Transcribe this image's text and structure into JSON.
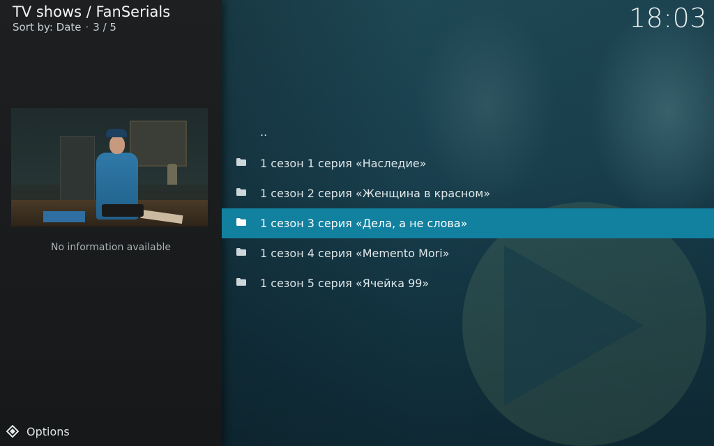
{
  "header": {
    "title": "TV shows / FanSerials",
    "sort_label": "Sort by: Date",
    "separator": "·",
    "position": "3 / 5"
  },
  "clock": "18:03",
  "info_panel": {
    "no_info_text": "No information available"
  },
  "footer": {
    "options_label": "Options"
  },
  "list": {
    "parent": "..",
    "items": [
      {
        "label": "1 сезон 1 серия «Наследие»",
        "icon": "folder-icon"
      },
      {
        "label": "1 сезон 2 серия «Женщина в красном»",
        "icon": "folder-icon"
      },
      {
        "label": "1 сезон 3 серия «Дела, а не слова»",
        "icon": "folder-icon",
        "selected": true
      },
      {
        "label": "1 сезон 4 серия «Memento Mori»",
        "icon": "folder-icon"
      },
      {
        "label": "1 сезон 5 серия «Ячейка 99»",
        "icon": "folder-icon"
      }
    ]
  },
  "colors": {
    "selection": "#12809f",
    "panel": "#1b1d1f"
  }
}
